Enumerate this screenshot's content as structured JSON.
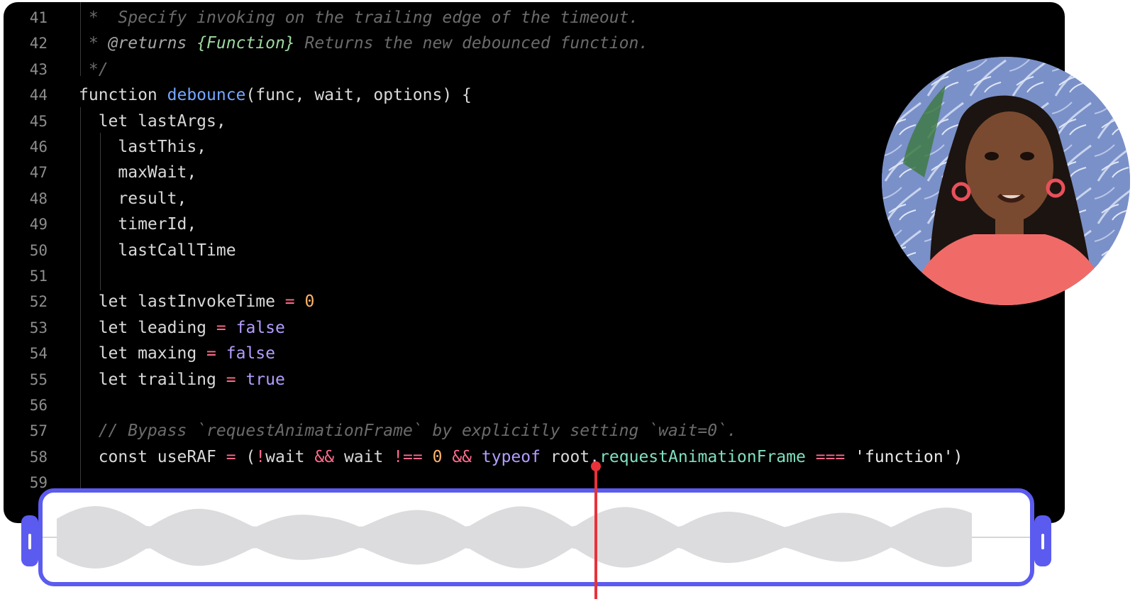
{
  "editor": {
    "lines": [
      {
        "n": "41",
        "segments": [
          {
            "c": "cm",
            "t": " *  Specify invoking on the trailing edge of the timeout."
          }
        ]
      },
      {
        "n": "42",
        "segments": [
          {
            "c": "cm",
            "t": " * "
          },
          {
            "c": "cmtag",
            "t": "@returns"
          },
          {
            "c": "cm",
            "t": " "
          },
          {
            "c": "cmtype",
            "t": "{Function}"
          },
          {
            "c": "cm",
            "t": " Returns the new debounced function."
          }
        ]
      },
      {
        "n": "43",
        "segments": [
          {
            "c": "cm",
            "t": " */"
          }
        ]
      },
      {
        "n": "44",
        "segments": [
          {
            "c": "kw",
            "t": "function "
          },
          {
            "c": "fn",
            "t": "debounce"
          },
          {
            "c": "kw",
            "t": "(func, wait, options) {"
          }
        ]
      },
      {
        "n": "45",
        "segments": [
          {
            "c": "kw",
            "t": "  let lastArgs,"
          }
        ]
      },
      {
        "n": "46",
        "segments": [
          {
            "c": "kw",
            "t": "    lastThis,"
          }
        ]
      },
      {
        "n": "47",
        "segments": [
          {
            "c": "kw",
            "t": "    maxWait,"
          }
        ]
      },
      {
        "n": "48",
        "segments": [
          {
            "c": "kw",
            "t": "    result,"
          }
        ]
      },
      {
        "n": "49",
        "segments": [
          {
            "c": "kw",
            "t": "    timerId,"
          }
        ]
      },
      {
        "n": "50",
        "segments": [
          {
            "c": "kw",
            "t": "    lastCallTime"
          }
        ]
      },
      {
        "n": "51",
        "segments": []
      },
      {
        "n": "52",
        "segments": [
          {
            "c": "kw",
            "t": "  let lastInvokeTime "
          },
          {
            "c": "op",
            "t": "="
          },
          {
            "c": "kw",
            "t": " "
          },
          {
            "c": "num",
            "t": "0"
          }
        ]
      },
      {
        "n": "53",
        "segments": [
          {
            "c": "kw",
            "t": "  let leading "
          },
          {
            "c": "op",
            "t": "="
          },
          {
            "c": "kw",
            "t": " "
          },
          {
            "c": "bool",
            "t": "false"
          }
        ]
      },
      {
        "n": "54",
        "segments": [
          {
            "c": "kw",
            "t": "  let maxing "
          },
          {
            "c": "op",
            "t": "="
          },
          {
            "c": "kw",
            "t": " "
          },
          {
            "c": "bool",
            "t": "false"
          }
        ]
      },
      {
        "n": "55",
        "segments": [
          {
            "c": "kw",
            "t": "  let trailing "
          },
          {
            "c": "op",
            "t": "="
          },
          {
            "c": "kw",
            "t": " "
          },
          {
            "c": "bool",
            "t": "true"
          }
        ]
      },
      {
        "n": "56",
        "segments": []
      },
      {
        "n": "57",
        "segments": [
          {
            "c": "cm",
            "t": "  // Bypass `requestAnimationFrame` by explicitly setting `wait=0`."
          }
        ]
      },
      {
        "n": "58",
        "segments": [
          {
            "c": "kw",
            "t": "  const useRAF "
          },
          {
            "c": "op",
            "t": "="
          },
          {
            "c": "kw",
            "t": " ("
          },
          {
            "c": "op",
            "t": "!"
          },
          {
            "c": "kw",
            "t": "wait "
          },
          {
            "c": "op",
            "t": "&&"
          },
          {
            "c": "kw",
            "t": " wait "
          },
          {
            "c": "op",
            "t": "!=="
          },
          {
            "c": "kw",
            "t": " "
          },
          {
            "c": "num",
            "t": "0"
          },
          {
            "c": "kw",
            "t": " "
          },
          {
            "c": "op",
            "t": "&&"
          },
          {
            "c": "kw",
            "t": " "
          },
          {
            "c": "bool",
            "t": "typeof"
          },
          {
            "c": "kw",
            "t": " root."
          },
          {
            "c": "prop",
            "t": "requestAnimationFrame"
          },
          {
            "c": "kw",
            "t": " "
          },
          {
            "c": "op",
            "t": "==="
          },
          {
            "c": "kw",
            "t": " "
          },
          {
            "c": "str",
            "t": "'function')"
          }
        ]
      },
      {
        "n": "59",
        "segments": []
      }
    ]
  },
  "timeline": {
    "playhead_position": 0.56
  },
  "icons": {
    "left_handle": "trim-handle-left-icon",
    "right_handle": "trim-handle-right-icon"
  },
  "colors": {
    "accent": "#5b5bf0",
    "playhead": "#e8323a",
    "waveform": "#dcdcdf",
    "editor_bg": "#000000"
  }
}
